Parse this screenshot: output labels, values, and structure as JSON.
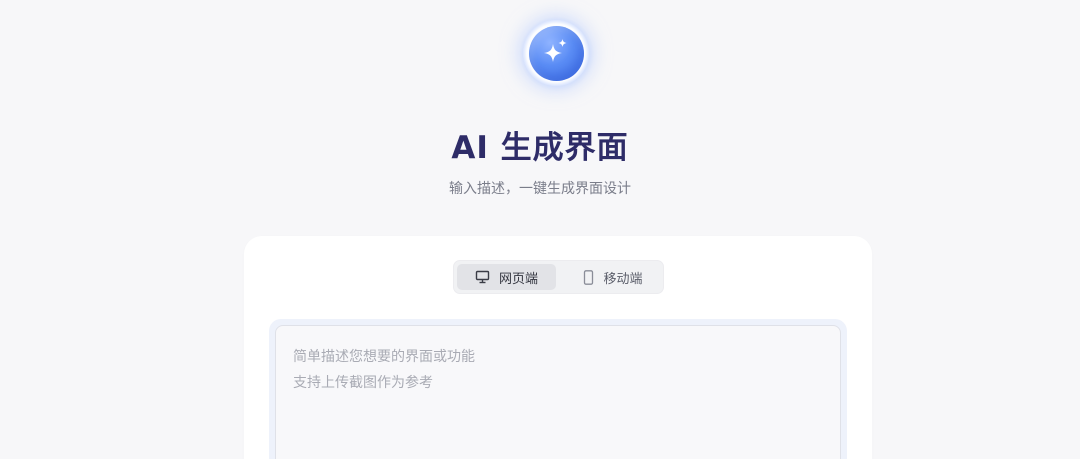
{
  "header": {
    "logo_icon": "sparkle-icon",
    "title": "AI 生成界面",
    "subtitle": "输入描述，一键生成界面设计"
  },
  "platform_toggle": {
    "selected": "web",
    "options": [
      {
        "id": "web",
        "label": "网页端",
        "icon": "monitor-icon"
      },
      {
        "id": "mobile",
        "label": "移动端",
        "icon": "phone-icon"
      }
    ]
  },
  "prompt": {
    "placeholder": "简单描述您想要的界面或功能\n支持上传截图作为参考"
  },
  "colors": {
    "accent": "#4f7ff0",
    "title": "#2e2c68",
    "background": "#f7f7f9"
  }
}
